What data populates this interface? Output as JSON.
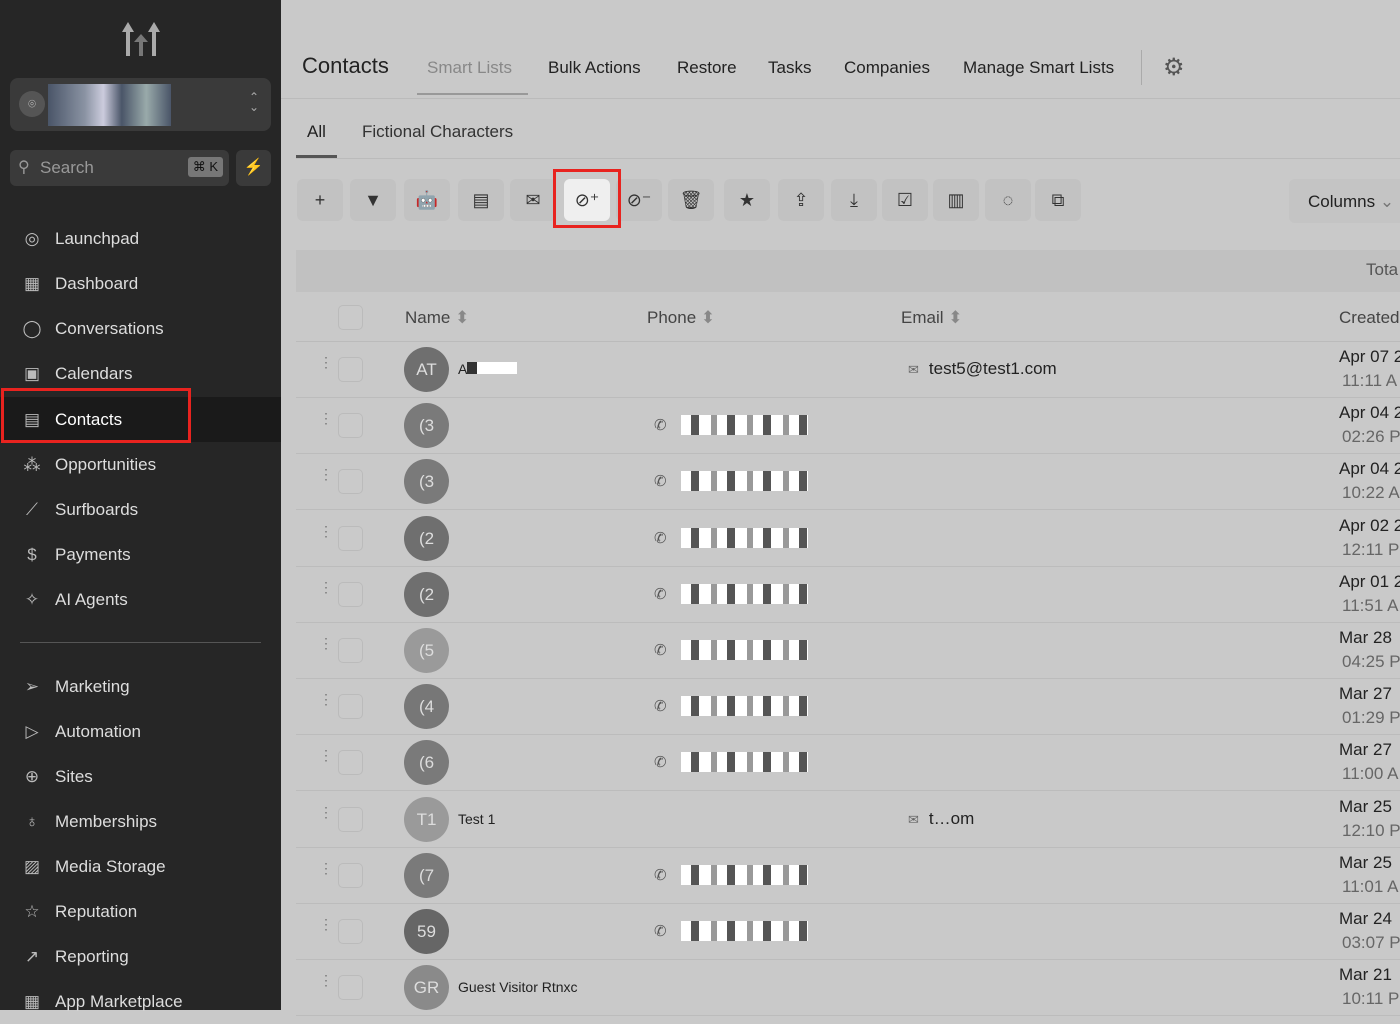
{
  "sidebar": {
    "search_placeholder": "Search",
    "search_shortcut": "⌘ K",
    "items": [
      {
        "label": "Launchpad",
        "icon": "rocket-icon",
        "glyph": "◎"
      },
      {
        "label": "Dashboard",
        "icon": "dashboard-icon",
        "glyph": "▦"
      },
      {
        "label": "Conversations",
        "icon": "chat-icon",
        "glyph": "◯"
      },
      {
        "label": "Calendars",
        "icon": "calendar-icon",
        "glyph": "▣"
      },
      {
        "label": "Contacts",
        "icon": "contacts-icon",
        "glyph": "▤"
      },
      {
        "label": "Opportunities",
        "icon": "opportunities-icon",
        "glyph": "⁂"
      },
      {
        "label": "Surfboards",
        "icon": "surfboard-icon",
        "glyph": "⟋"
      },
      {
        "label": "Payments",
        "icon": "payments-icon",
        "glyph": "$"
      },
      {
        "label": "AI Agents",
        "icon": "sparkle-icon",
        "glyph": "✧"
      },
      {
        "label": "Marketing",
        "icon": "send-icon",
        "glyph": "➢"
      },
      {
        "label": "Automation",
        "icon": "automation-icon",
        "glyph": "▷"
      },
      {
        "label": "Sites",
        "icon": "globe-icon",
        "glyph": "⊕"
      },
      {
        "label": "Memberships",
        "icon": "badge-icon",
        "glyph": "♁"
      },
      {
        "label": "Media Storage",
        "icon": "image-icon",
        "glyph": "▨"
      },
      {
        "label": "Reputation",
        "icon": "star-icon",
        "glyph": "☆"
      },
      {
        "label": "Reporting",
        "icon": "trend-icon",
        "glyph": "↗"
      },
      {
        "label": "App Marketplace",
        "icon": "apps-icon",
        "glyph": "▦"
      }
    ]
  },
  "header": {
    "title": "Contacts",
    "tabs": [
      "Smart Lists",
      "Bulk Actions",
      "Restore",
      "Tasks",
      "Companies",
      "Manage Smart Lists"
    ]
  },
  "subtabs": [
    "All",
    "Fictional Characters"
  ],
  "toolbar": {
    "buttons": [
      {
        "icon": "add-icon",
        "glyph": "+"
      },
      {
        "icon": "filter-icon",
        "glyph": "▼"
      },
      {
        "icon": "robot-icon",
        "glyph": "🤖"
      },
      {
        "icon": "message-icon",
        "glyph": "▤"
      },
      {
        "icon": "email-icon",
        "glyph": "✉"
      },
      {
        "icon": "add-tag-icon",
        "glyph": "⊘⁺"
      },
      {
        "icon": "remove-tag-icon",
        "glyph": "⊘⁻"
      },
      {
        "icon": "trash-icon",
        "glyph": "🗑"
      },
      {
        "icon": "star-icon",
        "glyph": "★"
      },
      {
        "icon": "export-icon",
        "glyph": "⇪"
      },
      {
        "icon": "import-icon",
        "glyph": "⤓"
      },
      {
        "icon": "review-icon",
        "glyph": "☑"
      },
      {
        "icon": "company-icon",
        "glyph": "▥"
      },
      {
        "icon": "whatsapp-icon",
        "glyph": "◌"
      },
      {
        "icon": "merge-icon",
        "glyph": "⧉"
      }
    ],
    "columns_label": "Columns"
  },
  "table": {
    "total_label": "Tota",
    "headers": {
      "name": "Name",
      "phone": "Phone",
      "email": "Email",
      "created": "Created"
    },
    "rows": [
      {
        "initials": "AT",
        "name": "A",
        "email": "test5@test1.com",
        "date": "Apr 07 2",
        "time": "11:11 A",
        "avatar": "#6f6f6f"
      },
      {
        "initials": "(3",
        "phone": true,
        "date": "Apr 04 2",
        "time": "02:26 P",
        "avatar": "#7a7a7a"
      },
      {
        "initials": "(3",
        "phone": true,
        "date": "Apr 04 2",
        "time": "10:22 A",
        "avatar": "#7a7a7a"
      },
      {
        "initials": "(2",
        "phone": true,
        "date": "Apr 02 2",
        "time": "12:11 P",
        "avatar": "#6f6f6f"
      },
      {
        "initials": "(2",
        "phone": true,
        "date": "Apr 01 2",
        "time": "11:51 A",
        "avatar": "#6f6f6f"
      },
      {
        "initials": "(5",
        "phone": true,
        "date": "Mar 28",
        "time": "04:25 P",
        "avatar": "#9a9a9a"
      },
      {
        "initials": "(4",
        "phone": true,
        "date": "Mar 27",
        "time": "01:29 P",
        "avatar": "#777777"
      },
      {
        "initials": "(6",
        "phone": true,
        "date": "Mar 27",
        "time": "11:00 A",
        "avatar": "#7a7a7a"
      },
      {
        "initials": "T1",
        "name": "Test 1",
        "email": "t…om",
        "date": "Mar 25",
        "time": "12:10 P",
        "avatar": "#9a9a9a"
      },
      {
        "initials": "(7",
        "phone": true,
        "date": "Mar 25",
        "time": "11:01 A",
        "avatar": "#7a7a7a"
      },
      {
        "initials": "59",
        "phone": true,
        "date": "Mar 24",
        "time": "03:07 P",
        "avatar": "#666666"
      },
      {
        "initials": "GR",
        "name": "Guest Visitor Rtnxc",
        "date": "Mar 21",
        "time": "10:11 P",
        "avatar": "#8a8a8a"
      }
    ]
  }
}
